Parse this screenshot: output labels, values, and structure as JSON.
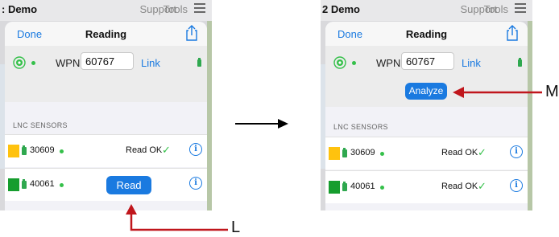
{
  "colors": {
    "accent": "#1a7ae0",
    "online_green": "#35c04a",
    "battery_green": "#2fa84f",
    "sensor_yellow": "#ffc20e",
    "sensor_green": "#169d2e",
    "annotation_red": "#c0161c"
  },
  "left_screen": {
    "topbar": {
      "brand": ": Demo",
      "support": "Support",
      "tools": "Tools"
    },
    "nav": {
      "done": "Done",
      "title": "Reading"
    },
    "wpn": {
      "label": "WPN",
      "value": "60767",
      "link": "Link"
    },
    "sensors": {
      "header": "LNC SENSORS",
      "rows": [
        {
          "id": "30609",
          "status": "Read OK",
          "check": "✓"
        },
        {
          "id": "40061",
          "button": "Read"
        }
      ]
    }
  },
  "right_screen": {
    "topbar": {
      "brand": "2 Demo",
      "support": "Support",
      "tools": "Tools"
    },
    "nav": {
      "done": "Done",
      "title": "Reading"
    },
    "wpn": {
      "label": "WPN",
      "value": "60767",
      "link": "Link",
      "analyze_button": "Analyze"
    },
    "sensors": {
      "header": "LNC SENSORS",
      "rows": [
        {
          "id": "30609",
          "status": "Read OK",
          "check": "✓"
        },
        {
          "id": "40061",
          "status": "Read OK",
          "check": "✓"
        }
      ]
    }
  },
  "annotations": {
    "left_label": "L",
    "right_label": "M"
  }
}
